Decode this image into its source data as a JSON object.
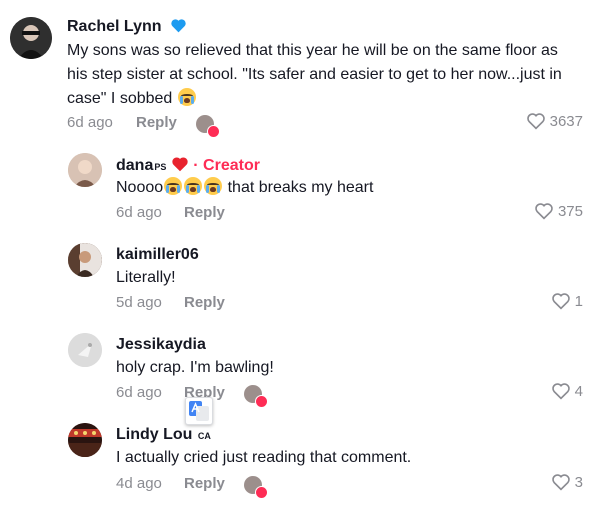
{
  "comments": [
    {
      "name": "Rachel Lynn",
      "text_line1": "My sons was so relieved that this year he will be on the same floor as",
      "text_line2": "his step sister at school. \"Its safer and easier to get to her now...just in",
      "text_line3": "case\" I sobbed",
      "time": "6d ago",
      "reply": "Reply",
      "likes": "3637"
    },
    {
      "name": "dana",
      "name_sup": "PS",
      "creator": "· Creator",
      "text_prefix": "Noooo",
      "text_suffix": " that breaks my heart",
      "time": "6d ago",
      "reply": "Reply",
      "likes": "375"
    },
    {
      "name": "kaimiller06",
      "text": "Literally!",
      "time": "5d ago",
      "reply": "Reply",
      "likes": "1"
    },
    {
      "name": "Jessikaydia",
      "text": "holy crap. I'm bawling!",
      "time": "6d ago",
      "reply": "Reply",
      "likes": "4"
    },
    {
      "name": "Lindy Lou",
      "name_sup": "CA",
      "text": "I actually cried just reading that comment.",
      "time": "4d ago",
      "reply": "Reply",
      "likes": "3"
    }
  ],
  "colors": {
    "accent": "#fe2c55",
    "muted": "#8a8b91",
    "verified_heart": "#1d9bf0"
  },
  "icons": [
    "blue-heart-icon",
    "red-heart-icon",
    "loudly-crying-emoji",
    "like-heart-icon",
    "translate-icon"
  ]
}
